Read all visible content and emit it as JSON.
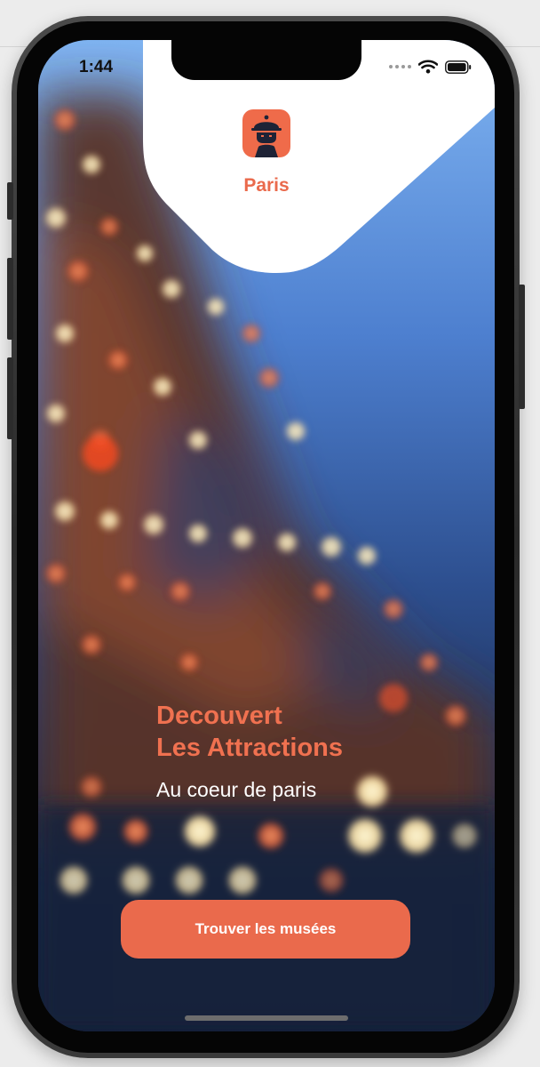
{
  "status_bar": {
    "time": "1:44"
  },
  "app": {
    "name": "Paris",
    "icon": "waiter-cloche-icon"
  },
  "hero": {
    "title_line1": "Decouvert",
    "title_line2": "Les Attractions",
    "subtitle": "Au coeur de paris"
  },
  "cta": {
    "label": "Trouver les musées"
  },
  "colors": {
    "accent": "#ea6a4c",
    "title": "#f07150",
    "subtitle": "#ffffff",
    "card": "#ffffff"
  }
}
